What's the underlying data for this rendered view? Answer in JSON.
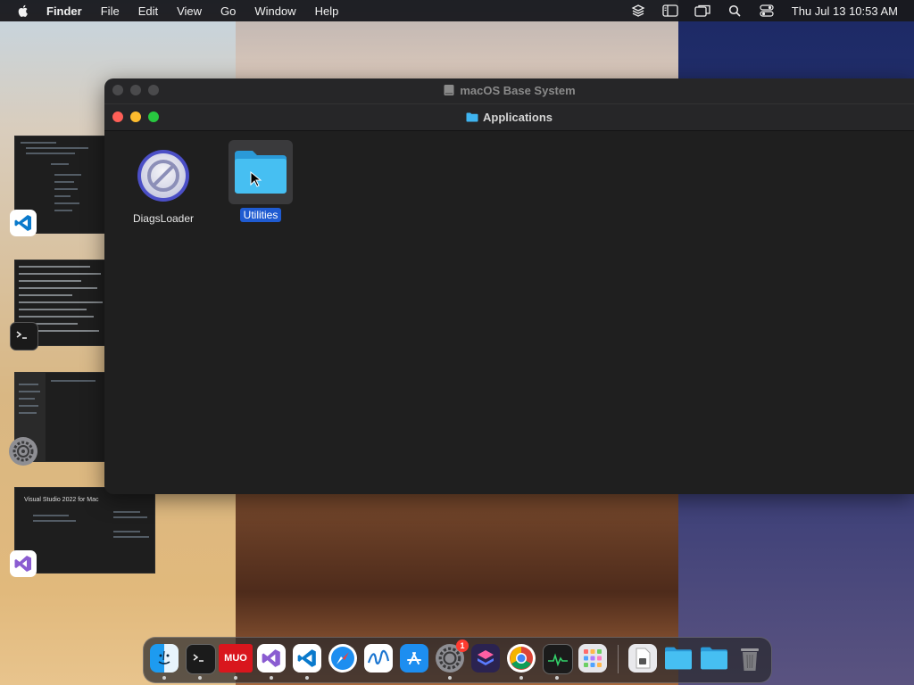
{
  "menubar": {
    "app_name": "Finder",
    "menus": [
      "File",
      "Edit",
      "View",
      "Go",
      "Window",
      "Help"
    ],
    "status_icons": [
      "layers-icon",
      "sidebar-icon",
      "screen-mirroring-icon",
      "spotlight-search-icon",
      "control-center-icon"
    ],
    "clock": "Thu Jul 13  10:53 AM"
  },
  "background_window": {
    "title": "macOS Base System",
    "icon": "disk-icon"
  },
  "finder_window": {
    "title": "Applications",
    "icon": "folder-icon",
    "items": [
      {
        "label": "DiagsLoader",
        "icon": "diags-loader-icon",
        "selected": false
      },
      {
        "label": "Utilities",
        "icon": "folder-icon",
        "selected": true
      }
    ]
  },
  "stage_manager": [
    {
      "app": "Visual Studio Code",
      "icon": "vscode-icon"
    },
    {
      "app": "Terminal",
      "icon": "terminal-icon"
    },
    {
      "app": "System Settings",
      "icon": "settings-gear-icon"
    },
    {
      "app": "Visual Studio",
      "icon": "visual-studio-icon",
      "thumb_text": "Visual Studio 2022 for Mac"
    }
  ],
  "dock": {
    "apps": [
      {
        "name": "Finder",
        "icon": "finder-icon",
        "running": true
      },
      {
        "name": "Terminal",
        "icon": "terminal-icon",
        "running": true
      },
      {
        "name": "MUO",
        "icon": "muo-icon",
        "label": "MUO",
        "running": true
      },
      {
        "name": "Visual Studio",
        "icon": "visual-studio-icon",
        "running": true
      },
      {
        "name": "Visual Studio Code",
        "icon": "vscode-icon",
        "running": true
      },
      {
        "name": "Safari",
        "icon": "safari-icon",
        "running": false
      },
      {
        "name": "Freeform",
        "icon": "freeform-icon",
        "running": false
      },
      {
        "name": "App Store",
        "icon": "app-store-icon",
        "running": false
      },
      {
        "name": "System Settings",
        "icon": "settings-gear-icon",
        "running": true,
        "badge": "1"
      },
      {
        "name": "Shortcuts",
        "icon": "shortcuts-icon",
        "running": false
      },
      {
        "name": "Chrome",
        "icon": "chrome-icon",
        "running": true
      },
      {
        "name": "Activity Monitor",
        "icon": "activity-monitor-icon",
        "running": true
      },
      {
        "name": "Launchpad",
        "icon": "launchpad-icon",
        "running": false
      }
    ],
    "others": [
      {
        "name": "Document",
        "icon": "document-icon"
      },
      {
        "name": "Applications Folder",
        "icon": "folder-icon"
      },
      {
        "name": "Downloads Folder",
        "icon": "folder-icon"
      },
      {
        "name": "Trash",
        "icon": "trash-icon"
      }
    ]
  },
  "colors": {
    "selection": "#1f5bd1",
    "close": "#ff5f57",
    "minimize": "#febc2e",
    "zoom": "#28c840",
    "folder": "#3fb4f0"
  }
}
